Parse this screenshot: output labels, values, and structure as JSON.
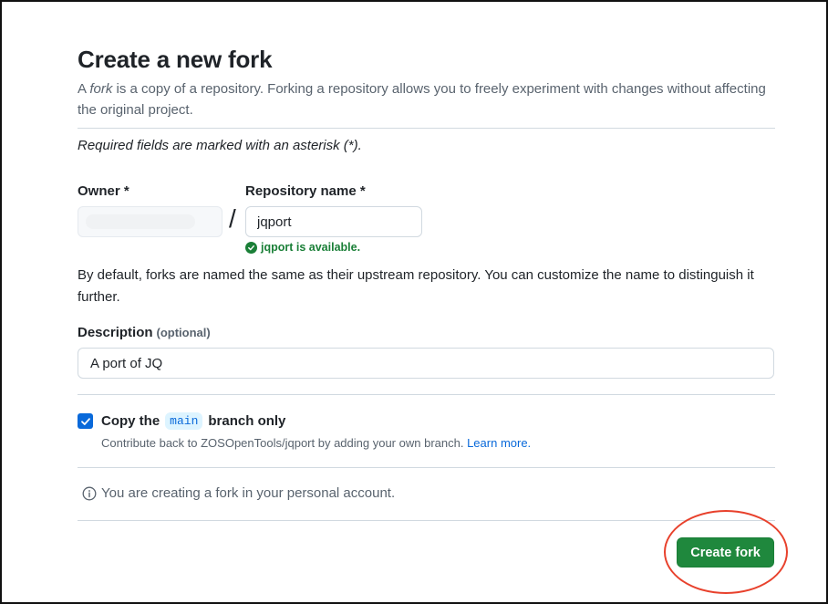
{
  "page": {
    "title": "Create a new fork",
    "intro_prefix": "A ",
    "intro_em": "fork",
    "intro_suffix": " is a copy of a repository. Forking a repository allows you to freely experiment with changes without affecting the original project.",
    "required_note": "Required fields are marked with an asterisk (*)."
  },
  "form": {
    "owner_label": "Owner *",
    "repo_label": "Repository name *",
    "repo_value": "jqport",
    "separator": "/",
    "availability": "jqport is available.",
    "naming_note": "By default, forks are named the same as their upstream repository. You can customize the name to distinguish it further.",
    "description_label": "Description",
    "description_optional": "(optional)",
    "description_value": "A port of JQ",
    "copy_prefix": "Copy the",
    "copy_branch": "main",
    "copy_suffix": "branch only",
    "copy_checked": true,
    "contribute_text": "Contribute back to ZOSOpenTools/jqport by adding your own branch.",
    "learn_more": "Learn more.",
    "info_text": "You are creating a fork in your personal account.",
    "submit_label": "Create fork"
  },
  "colors": {
    "primary_button": "#1f883d",
    "success": "#1a7f37",
    "link": "#0969da",
    "annotation": "#e8412c"
  },
  "icons": {
    "availability": "check-circle-icon",
    "info": "info-icon",
    "checkbox": "checkmark-icon"
  }
}
